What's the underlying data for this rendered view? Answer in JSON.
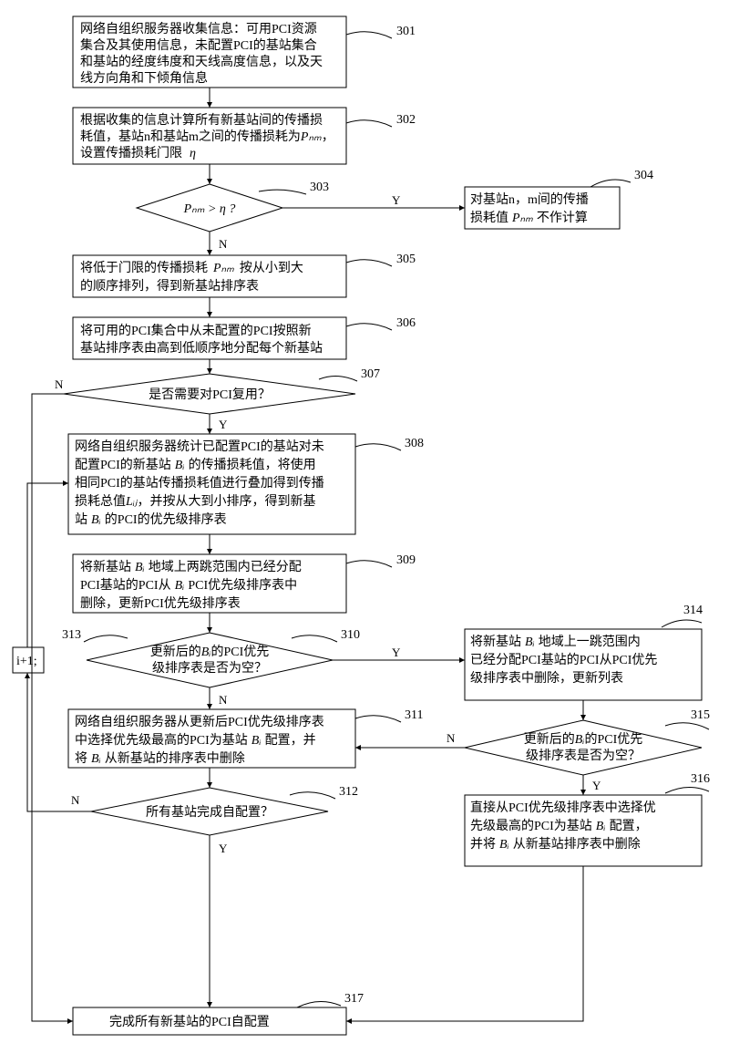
{
  "refs": {
    "r301": "301",
    "r302": "302",
    "r303": "303",
    "r304": "304",
    "r305": "305",
    "r306": "306",
    "r307": "307",
    "r308": "308",
    "r309": "309",
    "r310": "310",
    "r311": "311",
    "r312": "312",
    "r313": "313",
    "r314": "314",
    "r315": "315",
    "r316": "316",
    "r317": "317"
  },
  "boxes": {
    "b301_l1": "网络自组织服务器收集信息：可用PCI资源",
    "b301_l2": "集合及其使用信息，未配置PCI的基站集合",
    "b301_l3": "和基站的经度纬度和天线高度信息，以及天",
    "b301_l4": "线方向角和下倾角信息",
    "b302_l1": "根据收集的信息计算所有新基站间的传播损",
    "b302_l2": "耗值，基站n和基站m之间的传播损耗为",
    "b302_l3": "设置传播损耗门限",
    "b302_pnm": "Pₙₘ",
    "b302_eta": "η",
    "b303": "Pₙₘ > η ?",
    "b304_l1": "对基站n，m间的传播",
    "b304_l2": "损耗值",
    "b304_pnm": "Pₙₘ",
    "b304_l3": "不作计算",
    "b305_l1": "将低于门限的传播损耗",
    "b305_pnm": "Pₙₘ",
    "b305_l2": "按从小到大",
    "b305_l3": "的顺序排列，得到新基站排序表",
    "b306_l1": "将可用的PCI集合中从未配置的PCI按照新",
    "b306_l2": "基站排序表由高到低顺序地分配每个新基站",
    "b307": "是否需要对PCI复用？",
    "b308_l1": "网络自组织服务器统计已配置PCI的基站对未",
    "b308_l2": "配置PCI的新基站",
    "b308_bi1": "Bᵢ",
    "b308_l3": "的传播损耗值，将使用",
    "b308_l4": "相同PCI的基站传播损耗值进行叠加得到传播",
    "b308_l5": "损耗总值",
    "b308_lij": "Lᵢⱼ",
    "b308_l6": "，并按从大到小排序，得到新基",
    "b308_l7": "站",
    "b308_bi2": "Bᵢ",
    "b308_l8": "的PCI的优先级排序表",
    "b309_l1": "将新基站",
    "b309_bi1": "Bᵢ",
    "b309_l2": "地域上两跳范围内已经分配",
    "b309_l3": "PCI基站的PCI从",
    "b309_bi2": "Bᵢ",
    "b309_l4": "PCI优先级排序表中",
    "b309_l5": "删除，更新PCI优先级排序表",
    "b310_l1": "更新后的",
    "b310_bi": "Bᵢ",
    "b310_l2": "的PCI优先",
    "b310_l3": "级排序表是否为空？",
    "b311_l1": "网络自组织服务器从更新后PCI优先级排序表",
    "b311_l2": "中选择优先级最高的PCI为基站",
    "b311_bi1": "Bᵢ",
    "b311_l3": "配置，并",
    "b311_l4": "将",
    "b311_bi2": "Bᵢ",
    "b311_l5": "从新基站的排序表中删除",
    "b312": "所有基站完成自配置？",
    "b313": "i+1;",
    "b314_l1": "将新基站",
    "b314_bi": "Bᵢ",
    "b314_l2": "地域上一跳范围内",
    "b314_l3": "已经分配PCI基站的PCI从PCI优先",
    "b314_l4": "级排序表中删除，更新列表",
    "b315_l1": "更新后的",
    "b315_bi": "Bᵢ",
    "b315_l2": "的PCI优先",
    "b315_l3": "级排序表是否为空？",
    "b316_l1": "直接从PCI优先级排序表中选择优",
    "b316_l2": "先级最高的PCI为基站",
    "b316_bi1": "Bᵢ",
    "b316_l3": "配置，",
    "b316_l4": "并将",
    "b316_bi2": "Bᵢ",
    "b316_l5": "从新基站排序表中删除",
    "b317": "完成所有新基站的PCI自配置"
  },
  "yn": {
    "y": "Y",
    "n": "N"
  }
}
